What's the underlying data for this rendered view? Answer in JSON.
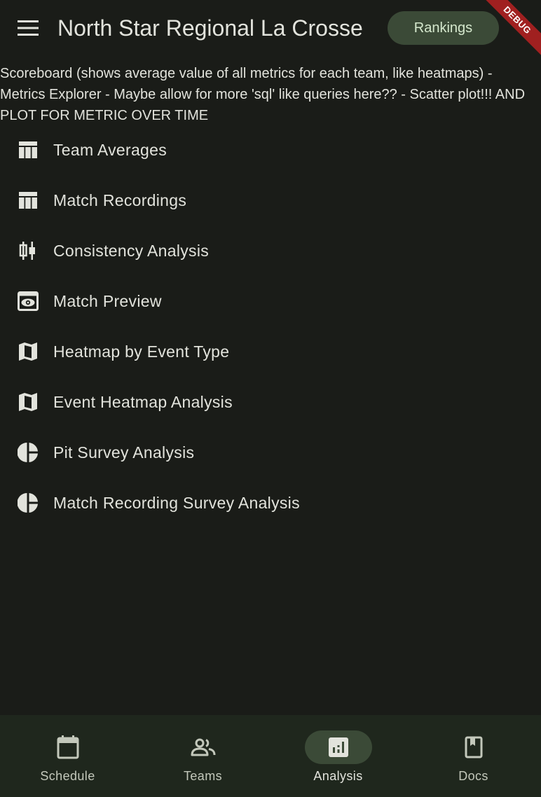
{
  "app_bar": {
    "title": "North Star Regional La Crosse",
    "rankings_label": "Rankings",
    "debug_label": "DEBUG",
    "menu_icon": "menu-icon"
  },
  "notes": "Scoreboard (shows average value of all metrics for each team, like heatmaps) - Metrics Explorer - Maybe allow for more 'sql' like queries here?? - Scatter plot!!! AND PLOT FOR METRIC OVER TIME",
  "analysis_items": [
    {
      "label": "Team Averages",
      "icon": "table-icon"
    },
    {
      "label": "Match Recordings",
      "icon": "table-icon"
    },
    {
      "label": "Consistency Analysis",
      "icon": "candlestick-icon"
    },
    {
      "label": "Match Preview",
      "icon": "preview-icon"
    },
    {
      "label": "Heatmap by Event Type",
      "icon": "map-icon"
    },
    {
      "label": "Event Heatmap Analysis",
      "icon": "map-icon"
    },
    {
      "label": "Pit Survey Analysis",
      "icon": "pie-chart-icon"
    },
    {
      "label": "Match Recording Survey Analysis",
      "icon": "pie-chart-icon"
    }
  ],
  "bottom_nav": {
    "items": [
      {
        "label": "Schedule",
        "icon": "calendar-icon",
        "active": false
      },
      {
        "label": "Teams",
        "icon": "people-icon",
        "active": false
      },
      {
        "label": "Analysis",
        "icon": "analytics-icon",
        "active": true
      },
      {
        "label": "Docs",
        "icon": "book-icon",
        "active": false
      }
    ]
  },
  "colors": {
    "background": "#1a1c18",
    "surface": "#1f271d",
    "accent_container": "#3b4a37",
    "on_surface": "#e2e3dc",
    "debug": "#a02020"
  }
}
